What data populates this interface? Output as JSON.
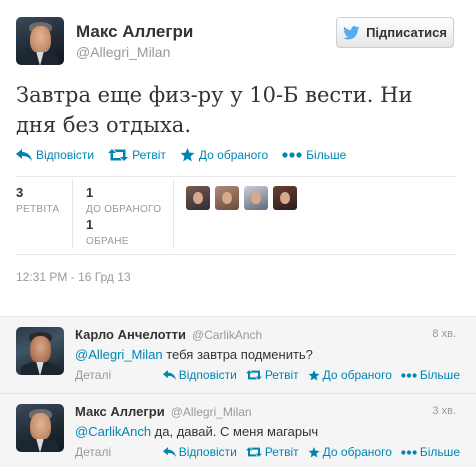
{
  "tweet": {
    "author_name": "Макс Аллегри",
    "author_handle": "@Allegri_Milan",
    "follow_label": "Підписатися",
    "text": "Завтра еще физ-ру у 10-Б вести. Ни дня без отдыха.",
    "actions": {
      "reply": "Відповісти",
      "retweet": "Ретвіт",
      "favorite": "До обраного",
      "more": "Більше"
    },
    "stats": {
      "retweets_count": "3",
      "retweets_label": "РЕТВІТА",
      "favorites_count": "1",
      "favorites_label": "ДО ОБРАНОГО",
      "favorited_count": "1",
      "favorited_label": "ОБРАНЕ"
    },
    "timestamp": "12:31 PM - 16 Грд 13"
  },
  "replies": [
    {
      "name": "Карло Анчелотти",
      "handle": "@CarlikAnch",
      "time": "8 хв.",
      "mention": "@Allegri_Milan",
      "text": " тебя завтра подменить?",
      "details": "Деталі",
      "reply": "Відповісти",
      "retweet": "Ретвіт",
      "favorite": "До обраного",
      "more": "Більше"
    },
    {
      "name": "Макс Аллегри",
      "handle": "@Allegri_Milan",
      "time": "3 хв.",
      "mention": "@CarlikAnch",
      "text": " да, давай. С меня магарыч",
      "details": "Деталі",
      "reply": "Відповісти",
      "retweet": "Ретвіт",
      "favorite": "До обраного",
      "more": "Більше"
    }
  ],
  "colors": {
    "link": "#0084b4",
    "muted": "#999999",
    "text": "#333333",
    "reply_bg": "#f5f5f5",
    "twitter_blue": "#55acee"
  },
  "icons": [
    "bird-icon",
    "reply-icon",
    "retweet-icon",
    "star-icon",
    "more-dots-icon"
  ]
}
